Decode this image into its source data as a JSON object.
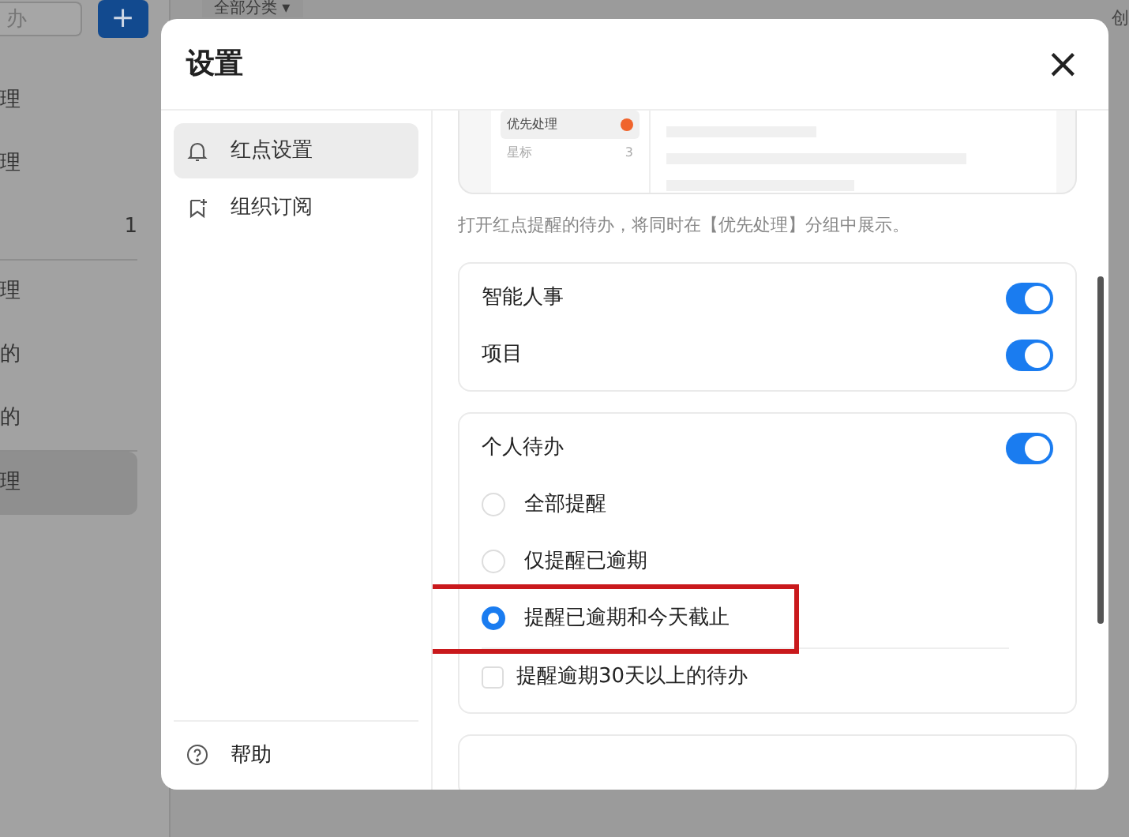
{
  "background": {
    "search": {
      "placeholder": "办"
    },
    "add_button": "+",
    "filter": {
      "label": "全部分类",
      "caret": "▾"
    },
    "column_header": "创",
    "sidebar_groups": [
      [
        {
          "label": "理",
          "selected": false
        },
        {
          "label": "理",
          "selected": false
        },
        {
          "count": "1",
          "selected": false
        }
      ],
      [
        {
          "label": "理",
          "selected": false
        },
        {
          "label": "的",
          "selected": false
        },
        {
          "label": "的",
          "selected": false
        }
      ],
      [
        {
          "label": "理",
          "selected": true
        }
      ]
    ]
  },
  "dialog": {
    "title": "设置",
    "close": "×",
    "nav": [
      {
        "kind": "bell",
        "label": "红点设置",
        "selected": true
      },
      {
        "kind": "bookmark",
        "label": "组织订阅",
        "selected": false
      }
    ],
    "help": "帮助",
    "preview": {
      "items": [
        {
          "label": "优先处理",
          "dot": true,
          "selected": true
        },
        {
          "label": "星标",
          "count": "3",
          "dot": false,
          "selected": false
        }
      ]
    },
    "caption": "打开红点提醒的待办，将同时在【优先处理】分组中展示。",
    "cards": [
      {
        "rows": [
          {
            "kind": "toggle",
            "label": "智能人事",
            "on": true
          },
          {
            "kind": "toggle",
            "label": "项目",
            "on": true
          }
        ]
      },
      {
        "rows": [
          {
            "kind": "toggle",
            "label": "个人待办",
            "on": true
          },
          {
            "kind": "radio",
            "label": "全部提醒",
            "selected": false
          },
          {
            "kind": "radio",
            "label": "仅提醒已逾期",
            "selected": false
          },
          {
            "kind": "radio",
            "label": "提醒已逾期和今天截止",
            "selected": true,
            "highlighted": true
          },
          {
            "kind": "checkbox",
            "label": "提醒逾期30天以上的待办",
            "checked": false
          }
        ]
      },
      {
        "kind": "clipped"
      }
    ]
  }
}
